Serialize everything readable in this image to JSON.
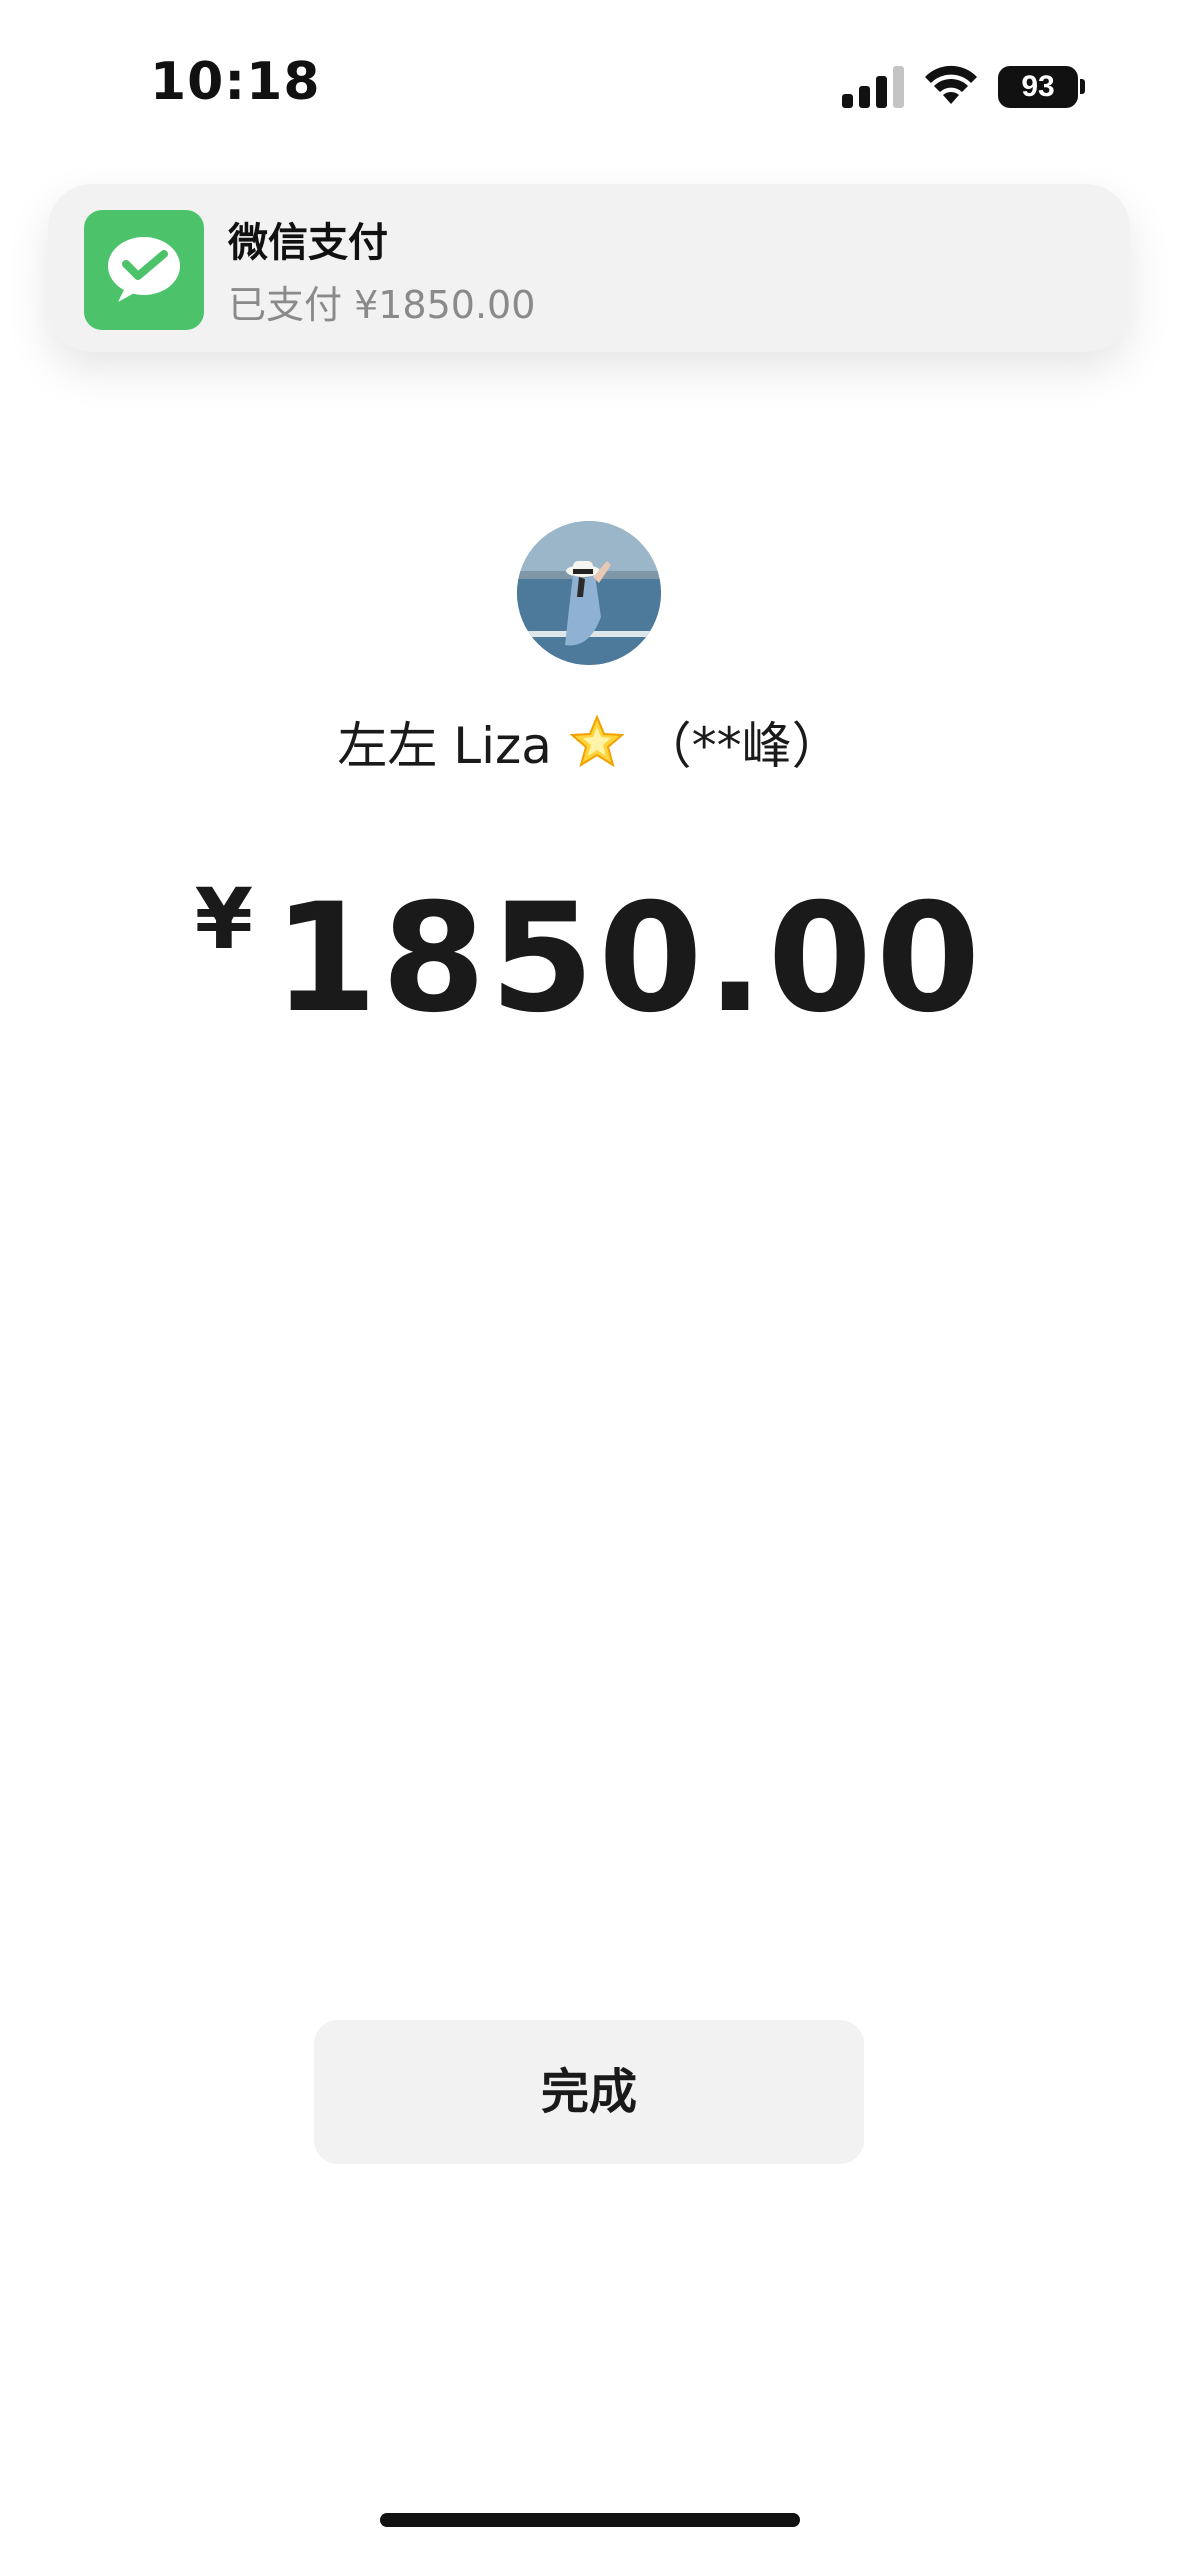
{
  "status_bar": {
    "time": "10:18",
    "battery": "93",
    "signal_icon": "cellular-signal-icon",
    "wifi_icon": "wifi-icon"
  },
  "notification": {
    "app_icon": "wechat-pay-icon",
    "app_icon_color": "#4cc36b",
    "title": "微信支付",
    "body": "已支付 ¥1850.00"
  },
  "payee": {
    "avatar": "avatar-photo",
    "name": "左左 Liza",
    "emoji": "glowing-star-icon",
    "masked_name": "（**峰）"
  },
  "payment": {
    "currency": "¥",
    "amount": "1850.00"
  },
  "actions": {
    "done_label": "完成"
  }
}
